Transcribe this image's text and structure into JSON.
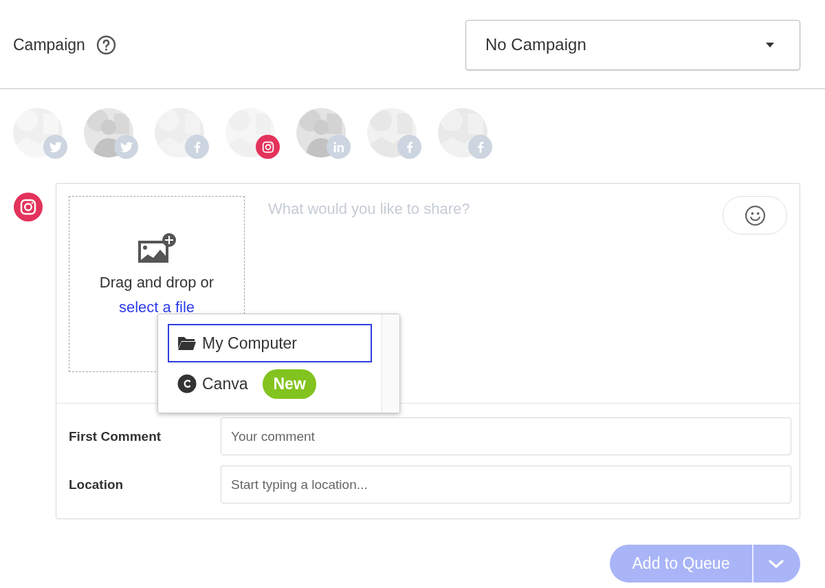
{
  "campaign": {
    "label": "Campaign",
    "value": "No Campaign"
  },
  "profiles": [
    {
      "kind": "twitter",
      "selected": false
    },
    {
      "kind": "twitter",
      "selected": false
    },
    {
      "kind": "facebook",
      "selected": false
    },
    {
      "kind": "instagram",
      "selected": true
    },
    {
      "kind": "linkedin",
      "selected": false
    },
    {
      "kind": "facebook",
      "selected": false
    },
    {
      "kind": "facebook",
      "selected": false
    }
  ],
  "composer": {
    "upload_text": "Drag and drop or",
    "upload_link": "select a file",
    "placeholder": "What would you like to share?"
  },
  "upload_menu": [
    {
      "kind": "folder",
      "label": "My Computer",
      "selected": true
    },
    {
      "kind": "canva",
      "label": "Canva",
      "badge": "New",
      "selected": false
    }
  ],
  "fields": [
    {
      "label": "First Comment",
      "placeholder": "Your comment"
    },
    {
      "label": "Location",
      "placeholder": "Start typing a location..."
    }
  ],
  "submit": {
    "label": "Add to Queue",
    "disabled": true
  }
}
